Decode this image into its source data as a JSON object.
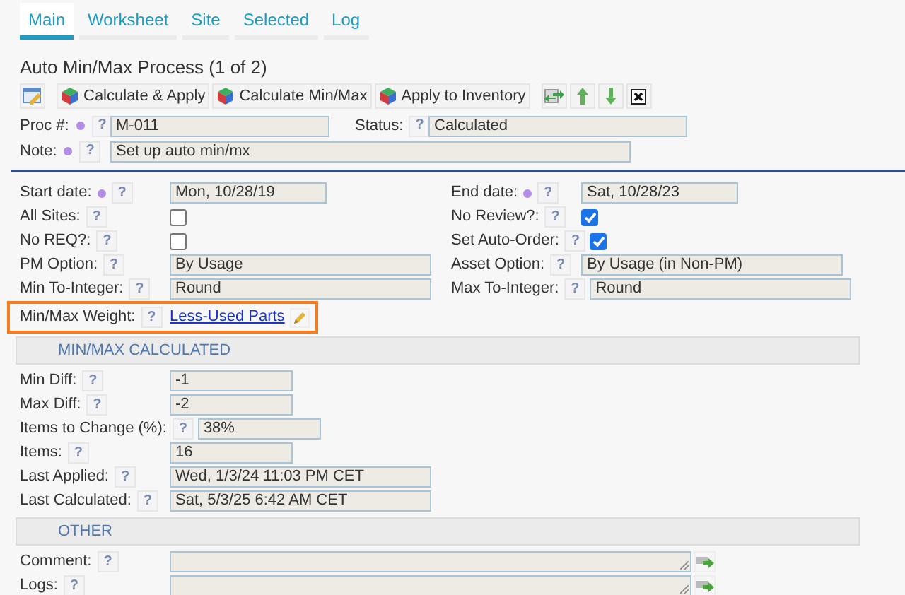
{
  "tabs": [
    {
      "label": "Main",
      "selected": true
    },
    {
      "label": "Worksheet",
      "selected": false
    },
    {
      "label": "Site",
      "selected": false
    },
    {
      "label": "Selected",
      "selected": false
    },
    {
      "label": "Log",
      "selected": false
    }
  ],
  "title": "Auto Min/Max Process (1 of 2)",
  "toolbar": [
    {
      "kind": "edit"
    },
    {
      "kind": "text",
      "label": "Calculate & Apply"
    },
    {
      "kind": "text",
      "label": "Calculate Min/Max"
    },
    {
      "kind": "text",
      "label": "Apply to Inventory"
    },
    {
      "kind": "refresh"
    },
    {
      "kind": "up"
    },
    {
      "kind": "down"
    },
    {
      "kind": "close"
    }
  ],
  "proc": {
    "label": "Proc #:",
    "required": true,
    "help": "?",
    "value": "M-011"
  },
  "status": {
    "label": "Status:",
    "help": "?",
    "value": "Calculated"
  },
  "note": {
    "label": "Note:",
    "required": true,
    "help": "?",
    "value": "Set up auto min/mx"
  },
  "rows": [
    [
      {
        "label": "Start date:",
        "required": true,
        "help": "?",
        "kind": "date",
        "value": "Mon, 10/28/19"
      },
      {
        "label": "End date:",
        "required": true,
        "help": "?",
        "kind": "date",
        "value": "Sat, 10/28/23"
      }
    ],
    [
      {
        "label": "All Sites:",
        "help": "?",
        "kind": "checkbox",
        "checked": false
      },
      {
        "label": "No Review?:",
        "help": "?",
        "kind": "checkbox",
        "checked": true
      }
    ],
    [
      {
        "label": "No REQ?:",
        "help": "?",
        "kind": "checkbox",
        "checked": false
      },
      {
        "label": "Set Auto-Order:",
        "help": "?",
        "kind": "checkbox",
        "checked": true
      }
    ],
    [
      {
        "label": "PM Option:",
        "help": "?",
        "kind": "select",
        "value": "By Usage"
      },
      {
        "label": "Asset Option:",
        "help": "?",
        "kind": "select",
        "value": "By Usage (in Non-PM)"
      }
    ],
    [
      {
        "label": "Min To-Integer:",
        "help": "?",
        "kind": "select",
        "value": "Round"
      },
      {
        "label": "Max To-Integer:",
        "help": "?",
        "kind": "select",
        "value": "Round"
      }
    ],
    [
      {
        "label": "Min/Max Weight:",
        "help": "?",
        "kind": "link",
        "value": "Less-Used Parts",
        "highlighted": true
      }
    ]
  ],
  "sections": [
    {
      "title": "MIN/MAX CALCULATED",
      "fields": [
        {
          "label": "Min Diff:",
          "help": "?",
          "kind": "number",
          "value": "-1"
        },
        {
          "label": "Max Diff:",
          "help": "?",
          "kind": "number",
          "value": "-2"
        },
        {
          "label": "Items to Change (%):",
          "help": "?",
          "kind": "number",
          "value": "38%"
        },
        {
          "label": "Items:",
          "help": "?",
          "kind": "number",
          "value": "16"
        },
        {
          "label": "Last Applied:",
          "help": "?",
          "kind": "datetime",
          "value": "Wed, 1/3/24 11:03 PM CET"
        },
        {
          "label": "Last Calculated:",
          "help": "?",
          "kind": "datetime",
          "value": "Sat, 5/3/25 6:42 AM CET"
        }
      ]
    },
    {
      "title": "OTHER",
      "fields": [
        {
          "label": "Comment:",
          "help": "?",
          "kind": "textarea"
        },
        {
          "label": "Logs:",
          "help": "?",
          "kind": "textarea"
        }
      ]
    }
  ]
}
